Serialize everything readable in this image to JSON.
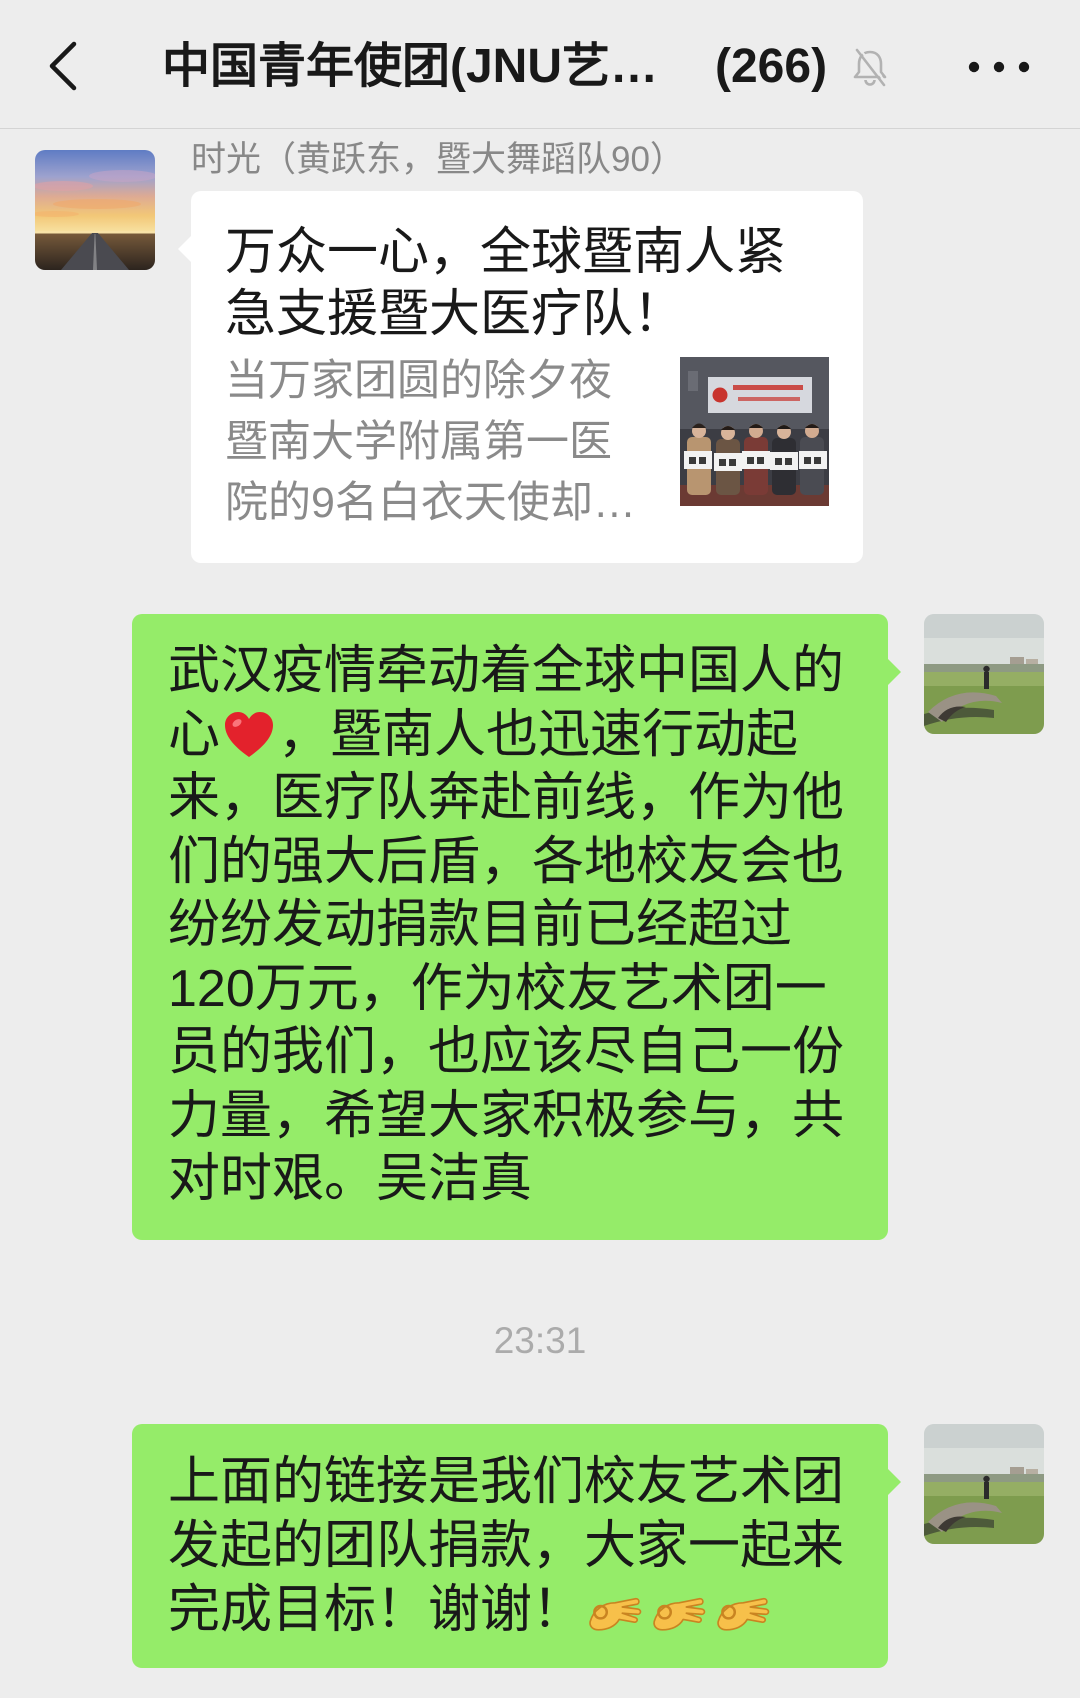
{
  "header": {
    "title": "中国青年使团(JNU艺…",
    "member_count": "(266)",
    "back_icon": "chevron-left-icon",
    "mute_icon": "bell-slash-icon",
    "more_icon": "more-dots-icon"
  },
  "colors": {
    "background": "#EDEDED",
    "outgoing_bubble": "#95EC69",
    "link_card": "#FFFFFF",
    "sender_name": "#888888",
    "timestamp": "#ABABAB",
    "primary_text": "#191919",
    "secondary_text": "#8A8A8A"
  },
  "chat": {
    "incoming_link": {
      "sender_name": "时光（黄跃东，暨大舞蹈队90）",
      "avatar_icon": "sunset-road-avatar-icon",
      "title_lines": [
        "万众一心，全球暨南人紧",
        "急支援暨大医疗队！"
      ],
      "description_lines": [
        "当万家团圆的除夕夜",
        "暨南大学附属第一医",
        "院的9名白衣天使却…"
      ],
      "thumbnail_icon": "group-photo-thumbnail-icon"
    },
    "outgoing_1": {
      "avatar_icon": "stone-bridge-avatar-icon",
      "lines": [
        "武汉疫情牵动着全球中国人的",
        {
          "before": "心",
          "icon": "red-heart-icon",
          "after": "，暨南人也迅速行动起"
        },
        "来，医疗队奔赴前线，作为他",
        "们的强大后盾，各地校友会也",
        "纷纷发动捐款目前已经超过",
        "120万元，作为校友艺术团一",
        "员的我们，也应该尽自己一份",
        "力量，希望大家积极参与，共",
        "对时艰。吴洁真"
      ]
    },
    "time_divider": "23:31",
    "outgoing_2": {
      "avatar_icon": "stone-bridge-avatar-icon",
      "lines": [
        "上面的链接是我们校友艺术团",
        "发起的团队捐款，大家一起来",
        {
          "before": "完成目标！谢谢！",
          "icons": [
            "ok-hand-icon",
            "ok-hand-icon",
            "ok-hand-icon"
          ]
        }
      ]
    }
  }
}
